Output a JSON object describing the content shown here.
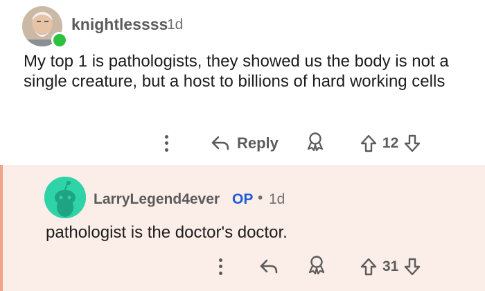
{
  "comments": [
    {
      "author": "knightlessss",
      "age": "1d",
      "online": true,
      "body": "My top 1 is pathologists, they showed us the body is not a single creature, but a host to billions of hard working cells",
      "actions": {
        "more_icon": "vertical-dots-icon",
        "reply_icon": "reply-arrow-icon",
        "reply_label": "Reply",
        "award_icon": "award-icon",
        "upvote_icon": "upvote-arrow-icon",
        "score": "12",
        "downvote_icon": "downvote-arrow-icon"
      }
    },
    {
      "author": "LarryLegend4ever",
      "op_badge": "OP",
      "separator": "•",
      "age": "1d",
      "body": "pathologist is the doctor's doctor.",
      "actions": {
        "more_icon": "vertical-dots-icon",
        "reply_icon": "reply-arrow-icon",
        "award_icon": "award-icon",
        "upvote_icon": "upvote-arrow-icon",
        "score": "31",
        "downvote_icon": "downvote-arrow-icon"
      }
    }
  ],
  "colors": {
    "reply_background": "#fbede7",
    "reply_thread_line": "#f0a48b",
    "op_badge": "#1f5bd6",
    "online_dot": "#2cc13f",
    "snoo_avatar": "#2fd3a8"
  }
}
